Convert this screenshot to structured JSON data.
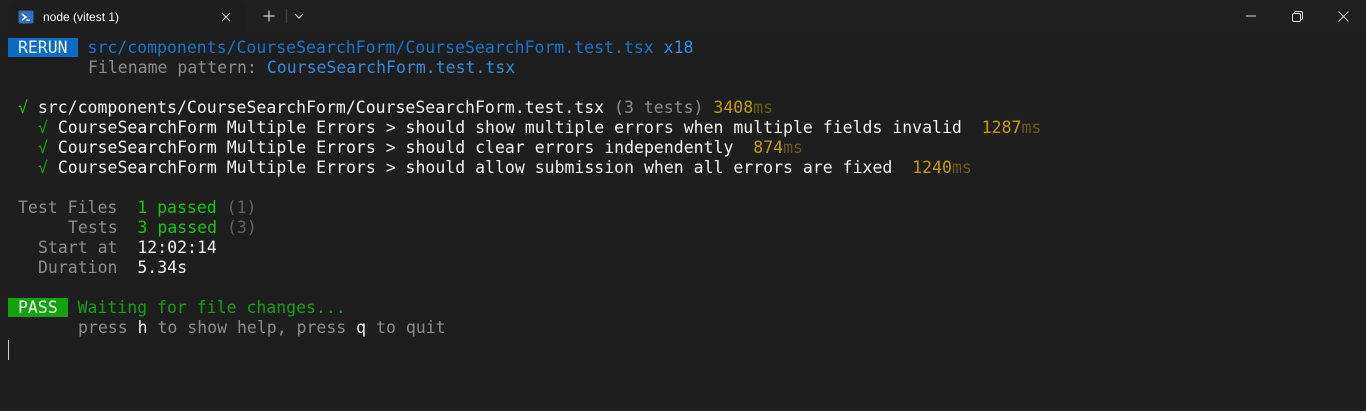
{
  "window": {
    "tab_title": "node (vitest 1)",
    "tab_icon": "powershell-icon",
    "controls": [
      "minimize-icon",
      "maximize-icon",
      "close-icon"
    ]
  },
  "terminal": {
    "rerun": {
      "badge": "RERUN",
      "path": "src/components/CourseSearchForm/CourseSearchForm.test.tsx",
      "count": "x18",
      "filter_label": "Filename pattern:",
      "filter_value": "CourseSearchForm.test.tsx"
    },
    "suite": {
      "check": "√",
      "file": "src/components/CourseSearchForm/CourseSearchForm.test.tsx",
      "tests": "(3 tests)",
      "time": "3408",
      "unit": "ms"
    },
    "tests": [
      {
        "check": "√",
        "name": "CourseSearchForm Multiple Errors > should show multiple errors when multiple fields invalid",
        "time": "1287",
        "unit": "ms"
      },
      {
        "check": "√",
        "name": "CourseSearchForm Multiple Errors > should clear errors independently",
        "time": "874",
        "unit": "ms"
      },
      {
        "check": "√",
        "name": "CourseSearchForm Multiple Errors > should allow submission when all errors are fixed",
        "time": "1240",
        "unit": "ms"
      }
    ],
    "summary": {
      "files_label": "Test Files",
      "files_passed": "1 passed",
      "files_total": "(1)",
      "tests_label": "Tests",
      "tests_passed": "3 passed",
      "tests_total": "(3)",
      "start_label": "Start at",
      "start_value": "12:02:14",
      "duration_label": "Duration",
      "duration_value": "5.34s"
    },
    "status": {
      "badge": "PASS",
      "message": "Waiting for file changes...",
      "help_1": "press",
      "help_key_1": "h",
      "help_2": "to show help, press",
      "help_key_2": "q",
      "help_3": "to quit"
    }
  },
  "colors": {
    "background": "#1e1e1e",
    "rerun_badge": "#0c6cc4",
    "pass_badge": "#13a10e",
    "pass_green": "#16c60c",
    "time_yellow": "#c19c00"
  }
}
